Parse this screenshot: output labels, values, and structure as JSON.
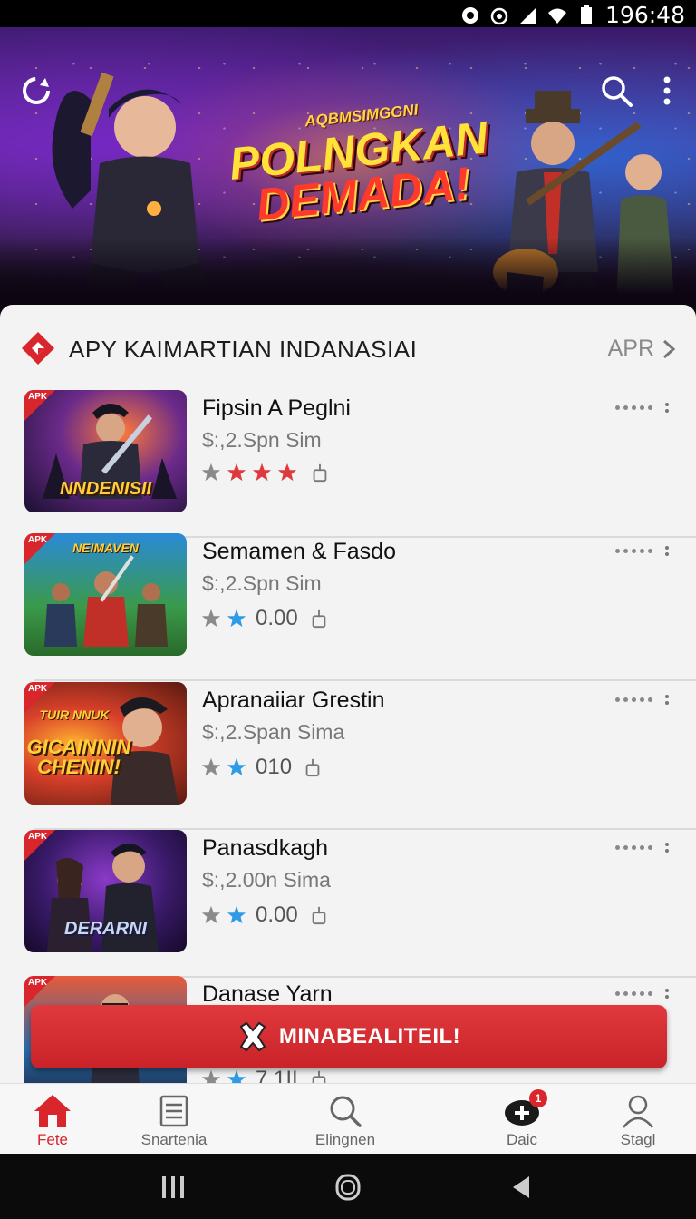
{
  "status_bar": {
    "time": "196:48"
  },
  "hero": {
    "subtitle": "AQBMSIMGGNI",
    "title_line1": "POLNGKAN",
    "title_line2": "DEMADA!"
  },
  "section": {
    "title": "APY KAIMARTIAN  INDANASIAI",
    "more_label": "APR"
  },
  "apps": [
    {
      "name": "Fipsin A Peglni",
      "price": "$:,2.Spn Sim",
      "rating": "",
      "thumb_text": "NNDENISII",
      "thumb_top": "",
      "stars": [
        "#8a8a8a",
        "#e0393d",
        "#e0393d",
        "#e0393d"
      ]
    },
    {
      "name": "Semamen & Fasdo",
      "price": "$:,2.Spn Sim",
      "rating": "0.00",
      "thumb_text": "",
      "thumb_top": "NEIMAVEN",
      "stars": [
        "#8a8a8a",
        "#2e9be6"
      ]
    },
    {
      "name": "Apranaiiar Grestin",
      "price": "$:,2.Span Sima",
      "rating": "010",
      "thumb_text": "GICAINNIN CHENIN!",
      "thumb_top": "TUIR NNUK",
      "stars": [
        "#8a8a8a",
        "#2e9be6"
      ]
    },
    {
      "name": "Panasdkagh",
      "price": "$:,2.00n Sima",
      "rating": "0.00",
      "thumb_text": "DERARNI",
      "thumb_top": "",
      "stars": [
        "#8a8a8a",
        "#2e9be6"
      ]
    },
    {
      "name": "Danase Yarn",
      "price": "",
      "rating": "7.1II",
      "thumb_text": "",
      "thumb_top": "",
      "stars": [
        "#8a8a8a",
        "#2e9be6"
      ]
    }
  ],
  "promo": {
    "label": "MINABEALITEIL!"
  },
  "bottom_nav": [
    {
      "label": "Fete",
      "icon": "home-icon",
      "active": true
    },
    {
      "label": "Snartenia",
      "icon": "list-icon",
      "active": false
    },
    {
      "label": "Elingnen",
      "icon": "search-icon",
      "active": false
    },
    {
      "label": "Daic",
      "icon": "gamepad-icon",
      "active": false,
      "badge": "1"
    },
    {
      "label": "Stagl",
      "icon": "profile-icon",
      "active": false
    }
  ],
  "colors": {
    "accent": "#d8262c",
    "sheet": "#f3f3f3"
  }
}
